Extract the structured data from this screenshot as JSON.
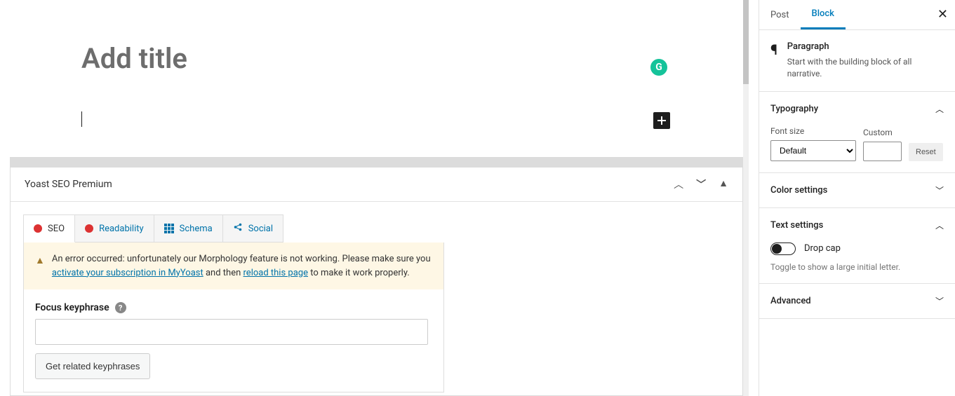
{
  "editor": {
    "titlePlaceholder": "Add title",
    "grammarlyBadge": "G"
  },
  "yoast": {
    "panelTitle": "Yoast SEO Premium",
    "tabs": {
      "seo": "SEO",
      "readability": "Readability",
      "schema": "Schema",
      "social": "Social"
    },
    "alert": {
      "part1": "An error occurred: unfortunately our Morphology feature is not working. Please make sure you ",
      "link1": "activate your subscription in MyYoast",
      "part2": " and then ",
      "link2": "reload this page",
      "part3": " to make it work properly."
    },
    "focusLabel": "Focus keyphrase",
    "relatedBtn": "Get related keyphrases"
  },
  "sidebar": {
    "tabs": {
      "post": "Post",
      "block": "Block"
    },
    "block": {
      "name": "Paragraph",
      "desc": "Start with the building block of all narrative."
    },
    "typography": {
      "title": "Typography",
      "fontSizeLabel": "Font size",
      "customLabel": "Custom",
      "fontSizeValue": "Default",
      "resetLabel": "Reset"
    },
    "colorSettings": {
      "title": "Color settings"
    },
    "textSettings": {
      "title": "Text settings",
      "dropCapLabel": "Drop cap",
      "dropCapDesc": "Toggle to show a large initial letter."
    },
    "advanced": {
      "title": "Advanced"
    }
  }
}
